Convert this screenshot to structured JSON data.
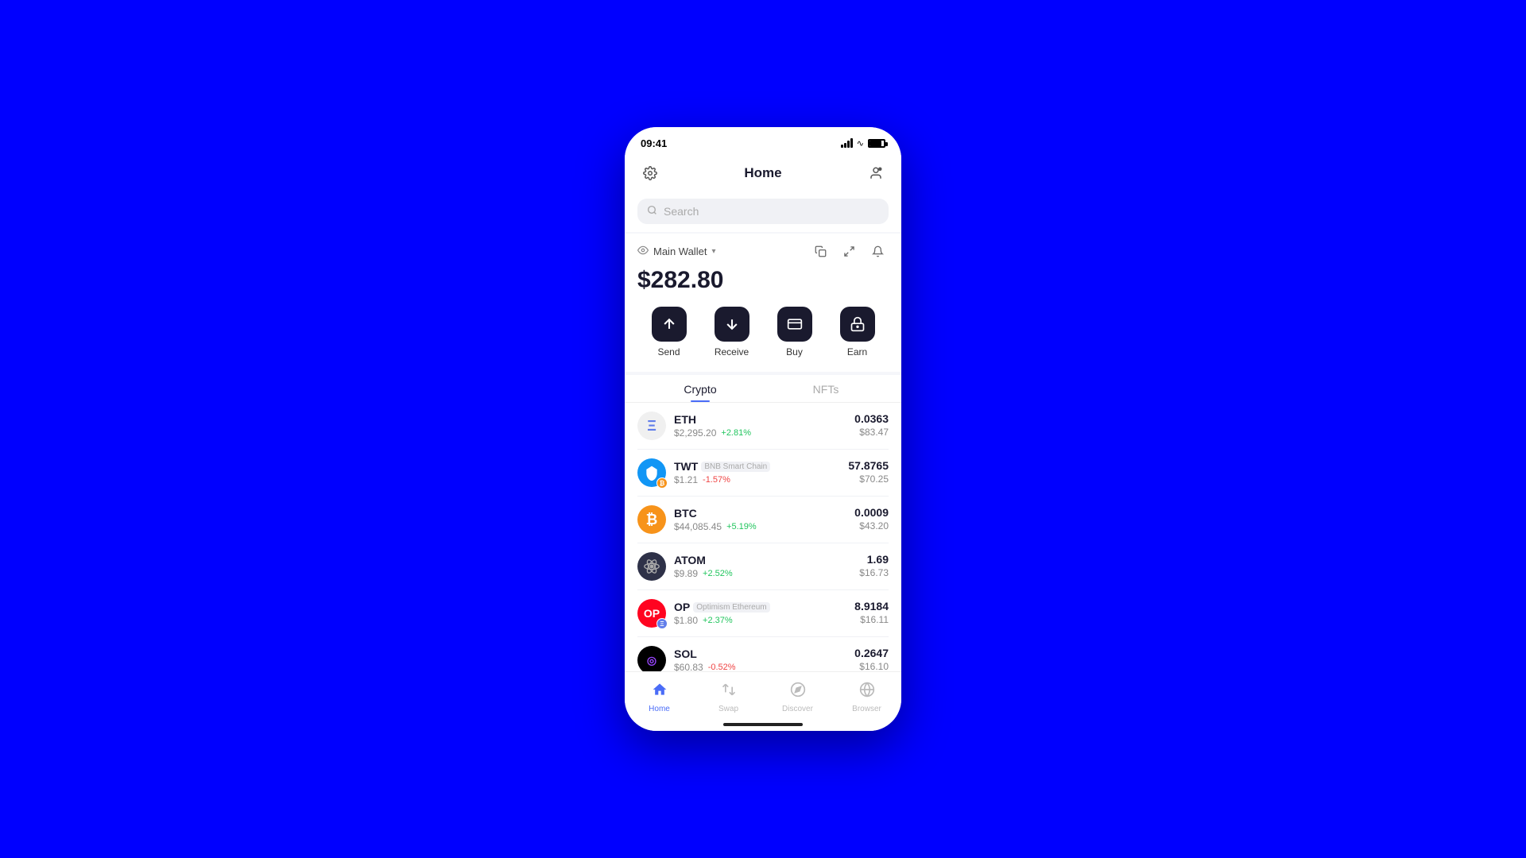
{
  "status": {
    "time": "09:41"
  },
  "header": {
    "title": "Home",
    "settings_label": "settings",
    "profile_label": "profile"
  },
  "search": {
    "placeholder": "Search"
  },
  "wallet": {
    "name": "Main Wallet",
    "balance": "$282.80",
    "eye_label": "visibility",
    "dropdown_label": "dropdown"
  },
  "actions": [
    {
      "id": "send",
      "label": "Send",
      "icon": "↑"
    },
    {
      "id": "receive",
      "label": "Receive",
      "icon": "↓"
    },
    {
      "id": "buy",
      "label": "Buy",
      "icon": "▬"
    },
    {
      "id": "earn",
      "label": "Earn",
      "icon": "🔒"
    }
  ],
  "tabs": [
    {
      "id": "crypto",
      "label": "Crypto",
      "active": true
    },
    {
      "id": "nfts",
      "label": "NFTs",
      "active": false
    }
  ],
  "tokens": [
    {
      "symbol": "ETH",
      "chain": "",
      "price": "$2,295.20",
      "change": "+2.81%",
      "positive": true,
      "quantity": "0.0363",
      "value": "$83.47",
      "logo_type": "eth",
      "logo_text": "Ξ"
    },
    {
      "symbol": "TWT",
      "chain": "BNB Smart Chain",
      "price": "$1.21",
      "change": "-1.57%",
      "positive": false,
      "quantity": "57.8765",
      "value": "$70.25",
      "logo_type": "twt",
      "logo_text": "T",
      "has_chain_badge": true
    },
    {
      "symbol": "BTC",
      "chain": "",
      "price": "$44,085.45",
      "change": "+5.19%",
      "positive": true,
      "quantity": "0.0009",
      "value": "$43.20",
      "logo_type": "btc",
      "logo_text": "₿"
    },
    {
      "symbol": "ATOM",
      "chain": "",
      "price": "$9.89",
      "change": "+2.52%",
      "positive": true,
      "quantity": "1.69",
      "value": "$16.73",
      "logo_type": "atom",
      "logo_text": "⚛"
    },
    {
      "symbol": "OP",
      "chain": "Optimism Ethereum",
      "price": "$1.80",
      "change": "+2.37%",
      "positive": true,
      "quantity": "8.9184",
      "value": "$16.11",
      "logo_type": "op",
      "logo_text": "OP",
      "has_chain_badge": true
    },
    {
      "symbol": "SOL",
      "chain": "",
      "price": "$60.83",
      "change": "-0.52%",
      "positive": false,
      "quantity": "0.2647",
      "value": "$16.10",
      "logo_type": "sol",
      "logo_text": "◎"
    }
  ],
  "bottom_nav": [
    {
      "id": "home",
      "label": "Home",
      "icon": "⌂",
      "active": true
    },
    {
      "id": "swap",
      "label": "Swap",
      "icon": "⇌",
      "active": false
    },
    {
      "id": "discover",
      "label": "Discover",
      "icon": "💡",
      "active": false
    },
    {
      "id": "browser",
      "label": "Browser",
      "icon": "🌐",
      "active": false
    }
  ]
}
